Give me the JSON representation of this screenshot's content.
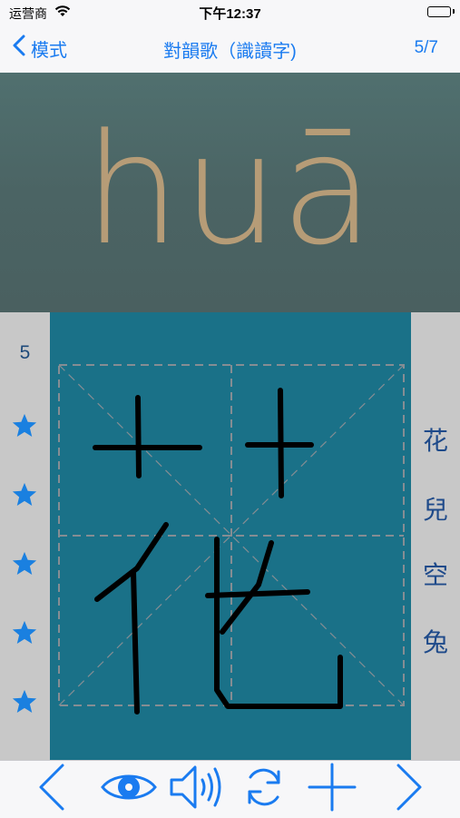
{
  "status_bar": {
    "carrier": "运营商",
    "time": "下午12:37"
  },
  "nav": {
    "back_label": "模式",
    "title": "對韻歌（識讀字)",
    "counter": "5/7"
  },
  "pinyin": "huā",
  "left_panel": {
    "level": "5",
    "stars": 5
  },
  "right_panel": {
    "words": [
      "花",
      "兒",
      "空",
      "兔"
    ]
  },
  "toolbar": {
    "buttons": [
      "previous-icon",
      "eye-icon",
      "speaker-icon",
      "refresh-icon",
      "plus-icon",
      "next-icon"
    ]
  },
  "colors": {
    "accent": "#1a7bf0",
    "pinyin": "#b69c77",
    "writing_bg": "#1a7188",
    "side_bg": "#c8c8c8",
    "grid": "#8a8a8a"
  }
}
